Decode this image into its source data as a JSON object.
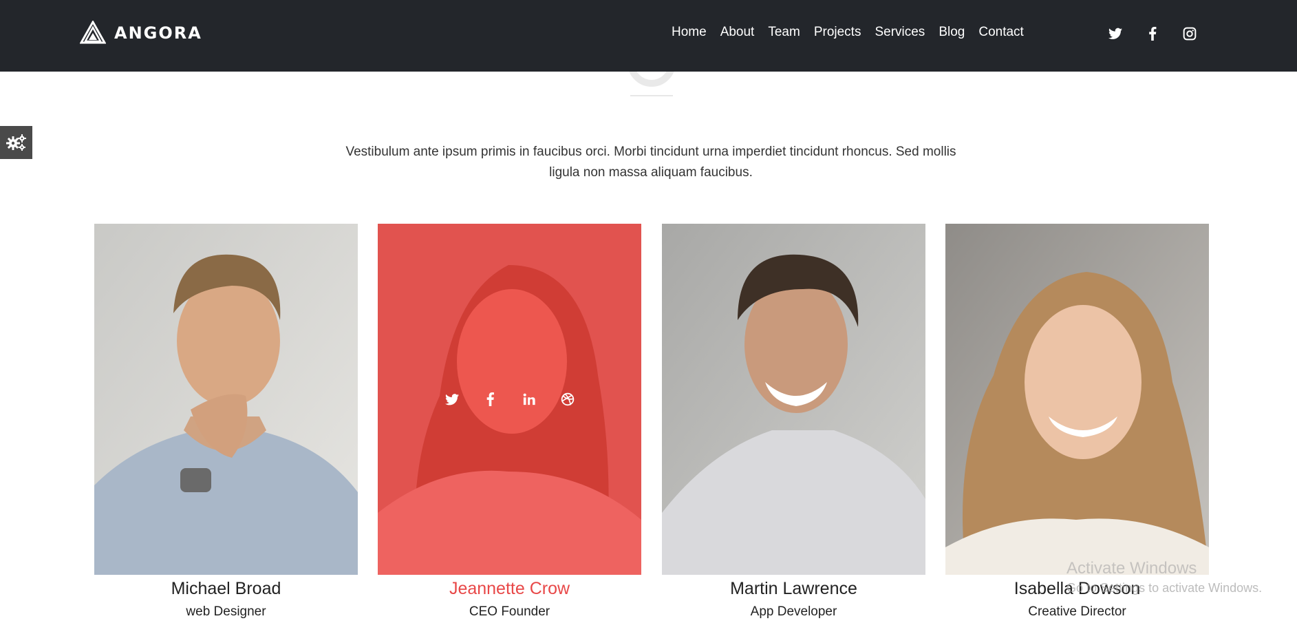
{
  "brand": {
    "name": "ANGORA"
  },
  "nav": {
    "items": [
      "Home",
      "About",
      "Team",
      "Projects",
      "Services",
      "Blog",
      "Contact"
    ]
  },
  "social_header": [
    "twitter-icon",
    "facebook-icon",
    "instagram-icon"
  ],
  "intro": {
    "line1": "Vestibulum ante ipsum primis in faucibus orci. Morbi tincidunt urna imperdiet tincidunt rhoncus. Sed mollis",
    "line2": "ligula non massa aliquam faucibus."
  },
  "team": [
    {
      "name": "Michael Broad",
      "role": "web Designer",
      "active": false
    },
    {
      "name": "Jeannette Crow",
      "role": "CEO Founder",
      "active": true
    },
    {
      "name": "Martin Lawrence",
      "role": "App Developer",
      "active": false
    },
    {
      "name": "Isabella Dowson",
      "role": "Creative Director",
      "active": false
    }
  ],
  "overlay_icons": [
    "twitter-icon",
    "facebook-icon",
    "linkedin-icon",
    "dribbble-icon"
  ],
  "watermark": {
    "title": "Activate Windows",
    "subtitle": "Go to Settings to activate Windows."
  },
  "colors": {
    "header_bg": "#23262b",
    "accent": "#e84848",
    "overlay": "rgba(240,50,50,0.72)"
  }
}
